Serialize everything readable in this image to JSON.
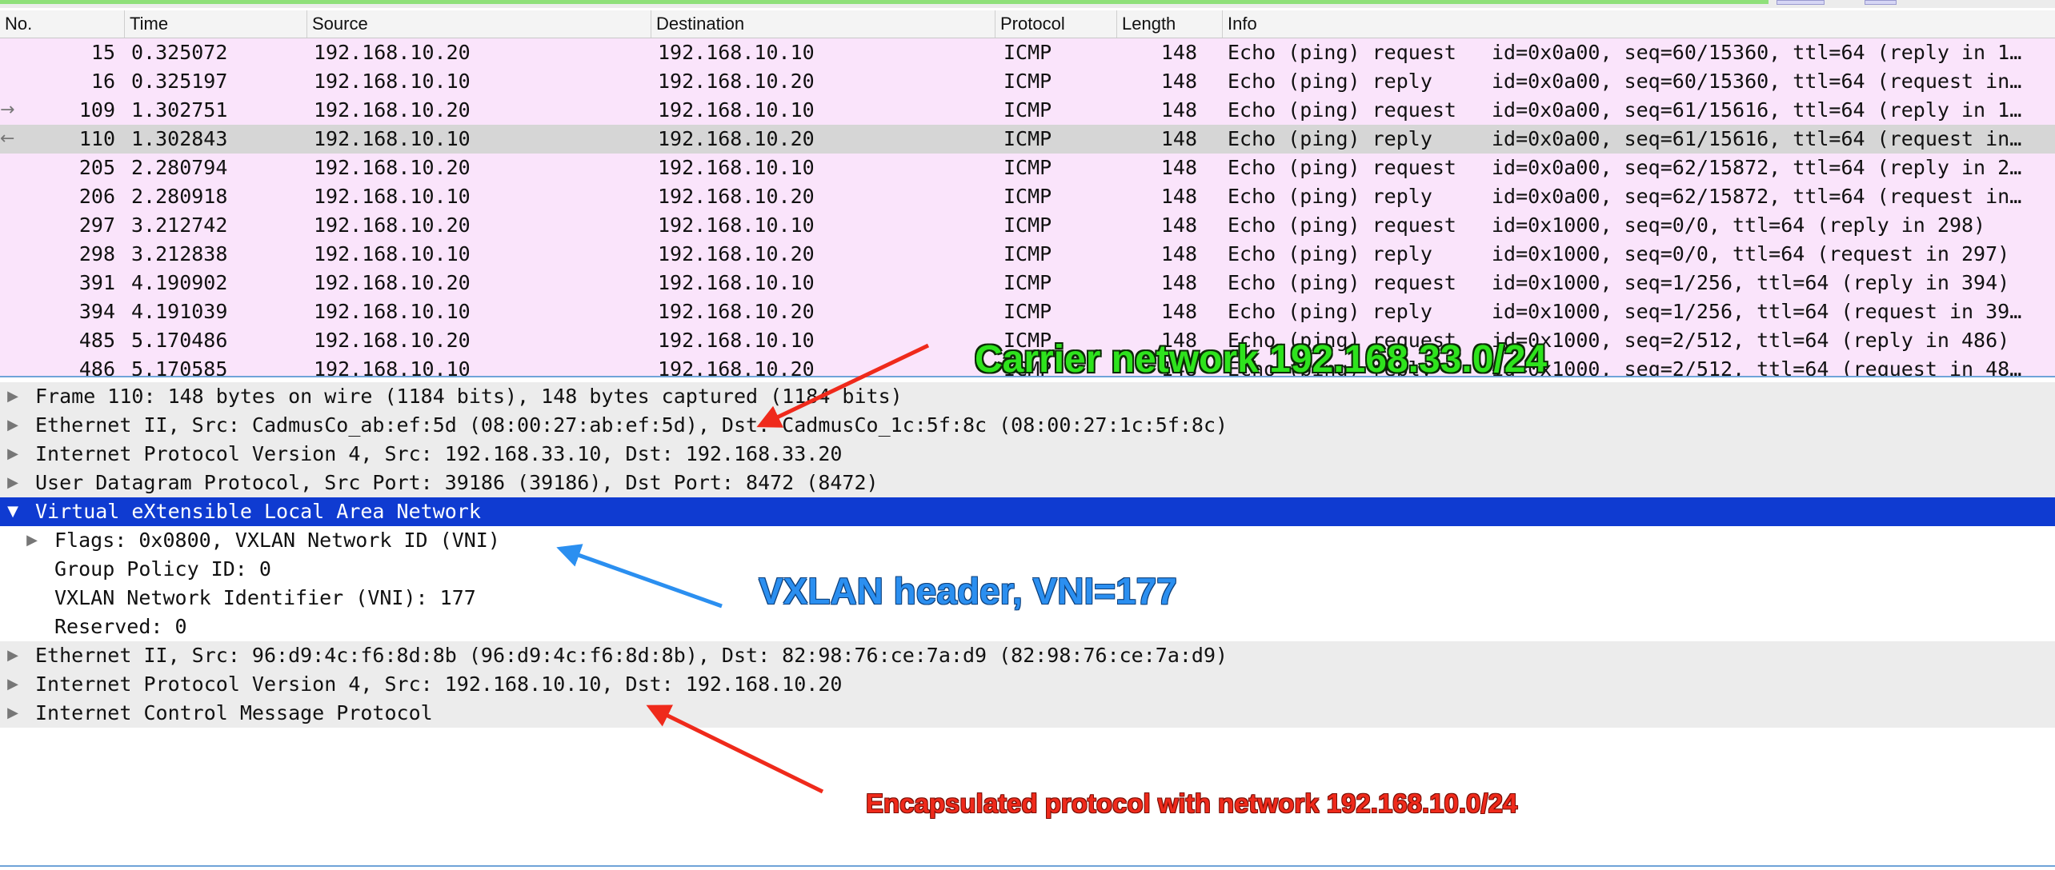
{
  "columns": {
    "no": "No.",
    "time": "Time",
    "source": "Source",
    "destination": "Destination",
    "protocol": "Protocol",
    "length": "Length",
    "info": "Info"
  },
  "packets": [
    {
      "no": "15",
      "time": "0.325072",
      "source": "192.168.10.20",
      "destination": "192.168.10.10",
      "protocol": "ICMP",
      "length": "148",
      "type": "Echo (ping) request",
      "detail": "id=0x0a00, seq=60/15360, ttl=64 (reply in 1…",
      "marker": ""
    },
    {
      "no": "16",
      "time": "0.325197",
      "source": "192.168.10.10",
      "destination": "192.168.10.20",
      "protocol": "ICMP",
      "length": "148",
      "type": "Echo (ping) reply",
      "detail": "id=0x0a00, seq=60/15360, ttl=64 (request in…",
      "marker": ""
    },
    {
      "no": "109",
      "time": "1.302751",
      "source": "192.168.10.20",
      "destination": "192.168.10.10",
      "protocol": "ICMP",
      "length": "148",
      "type": "Echo (ping) request",
      "detail": "id=0x0a00, seq=61/15616, ttl=64 (reply in 1…",
      "marker": "→"
    },
    {
      "no": "110",
      "time": "1.302843",
      "source": "192.168.10.10",
      "destination": "192.168.10.20",
      "protocol": "ICMP",
      "length": "148",
      "type": "Echo (ping) reply",
      "detail": "id=0x0a00, seq=61/15616, ttl=64 (request in…",
      "marker": "←"
    },
    {
      "no": "205",
      "time": "2.280794",
      "source": "192.168.10.20",
      "destination": "192.168.10.10",
      "protocol": "ICMP",
      "length": "148",
      "type": "Echo (ping) request",
      "detail": "id=0x0a00, seq=62/15872, ttl=64 (reply in 2…",
      "marker": ""
    },
    {
      "no": "206",
      "time": "2.280918",
      "source": "192.168.10.10",
      "destination": "192.168.10.20",
      "protocol": "ICMP",
      "length": "148",
      "type": "Echo (ping) reply",
      "detail": "id=0x0a00, seq=62/15872, ttl=64 (request in…",
      "marker": ""
    },
    {
      "no": "297",
      "time": "3.212742",
      "source": "192.168.10.20",
      "destination": "192.168.10.10",
      "protocol": "ICMP",
      "length": "148",
      "type": "Echo (ping) request",
      "detail": "id=0x1000, seq=0/0, ttl=64 (reply in 298)",
      "marker": ""
    },
    {
      "no": "298",
      "time": "3.212838",
      "source": "192.168.10.10",
      "destination": "192.168.10.20",
      "protocol": "ICMP",
      "length": "148",
      "type": "Echo (ping) reply",
      "detail": "id=0x1000, seq=0/0, ttl=64 (request in 297)",
      "marker": ""
    },
    {
      "no": "391",
      "time": "4.190902",
      "source": "192.168.10.20",
      "destination": "192.168.10.10",
      "protocol": "ICMP",
      "length": "148",
      "type": "Echo (ping) request",
      "detail": "id=0x1000, seq=1/256, ttl=64 (reply in 394)",
      "marker": ""
    },
    {
      "no": "394",
      "time": "4.191039",
      "source": "192.168.10.10",
      "destination": "192.168.10.20",
      "protocol": "ICMP",
      "length": "148",
      "type": "Echo (ping) reply",
      "detail": "id=0x1000, seq=1/256, ttl=64 (request in 39…",
      "marker": ""
    },
    {
      "no": "485",
      "time": "5.170486",
      "source": "192.168.10.20",
      "destination": "192.168.10.10",
      "protocol": "ICMP",
      "length": "148",
      "type": "Echo (ping) request",
      "detail": "id=0x1000, seq=2/512, ttl=64 (reply in 486)",
      "marker": ""
    },
    {
      "no": "486",
      "time": "5.170585",
      "source": "192.168.10.10",
      "destination": "192.168.10.20",
      "protocol": "ICMP",
      "length": "148",
      "type": "Echo (ping) reply",
      "detail": "id=0x1000, seq=2/512, ttl=64 (request in 48…",
      "marker": ""
    }
  ],
  "selected_packet_index": 3,
  "details": [
    {
      "text": "Frame 110: 148 bytes on wire (1184 bits), 148 bytes captured (1184 bits)",
      "expanded": false,
      "indent": 0,
      "style": "grey"
    },
    {
      "text": "Ethernet II, Src: CadmusCo_ab:ef:5d (08:00:27:ab:ef:5d), Dst: CadmusCo_1c:5f:8c (08:00:27:1c:5f:8c)",
      "expanded": false,
      "indent": 0,
      "style": "grey"
    },
    {
      "text": "Internet Protocol Version 4, Src: 192.168.33.10, Dst: 192.168.33.20",
      "expanded": false,
      "indent": 0,
      "style": "grey"
    },
    {
      "text": "User Datagram Protocol, Src Port: 39186 (39186), Dst Port: 8472 (8472)",
      "expanded": false,
      "indent": 0,
      "style": "grey"
    },
    {
      "text": "Virtual eXtensible Local Area Network",
      "expanded": true,
      "indent": 0,
      "style": "highlight"
    },
    {
      "text": "Flags: 0x0800, VXLAN Network ID (VNI)",
      "expanded": false,
      "indent": 1,
      "style": "plain"
    },
    {
      "text": "Group Policy ID: 0",
      "expanded": null,
      "indent": 1,
      "style": "plain"
    },
    {
      "text": "VXLAN Network Identifier (VNI): 177",
      "expanded": null,
      "indent": 1,
      "style": "plain"
    },
    {
      "text": "Reserved: 0",
      "expanded": null,
      "indent": 1,
      "style": "plain"
    },
    {
      "text": "Ethernet II, Src: 96:d9:4c:f6:8d:8b (96:d9:4c:f6:8d:8b), Dst: 82:98:76:ce:7a:d9 (82:98:76:ce:7a:d9)",
      "expanded": false,
      "indent": 0,
      "style": "grey"
    },
    {
      "text": "Internet Protocol Version 4, Src: 192.168.10.10, Dst: 192.168.10.20",
      "expanded": false,
      "indent": 0,
      "style": "grey"
    },
    {
      "text": "Internet Control Message Protocol",
      "expanded": false,
      "indent": 0,
      "style": "grey"
    }
  ],
  "annotations": {
    "carrier": "Carrier network 192.168.33.0/24",
    "vxlan": "VXLAN header, VNI=177",
    "encapsulated": "Encapsulated protocol with network 192.168.10.0/24"
  },
  "colors": {
    "row_bg": "#fae4fb",
    "selected_row_bg": "#d6d6d6",
    "highlight_bg": "#0f3bd1",
    "annotation_green": "#2ee31d",
    "annotation_blue": "#2b8ff0",
    "annotation_red": "#ef2a1b"
  }
}
